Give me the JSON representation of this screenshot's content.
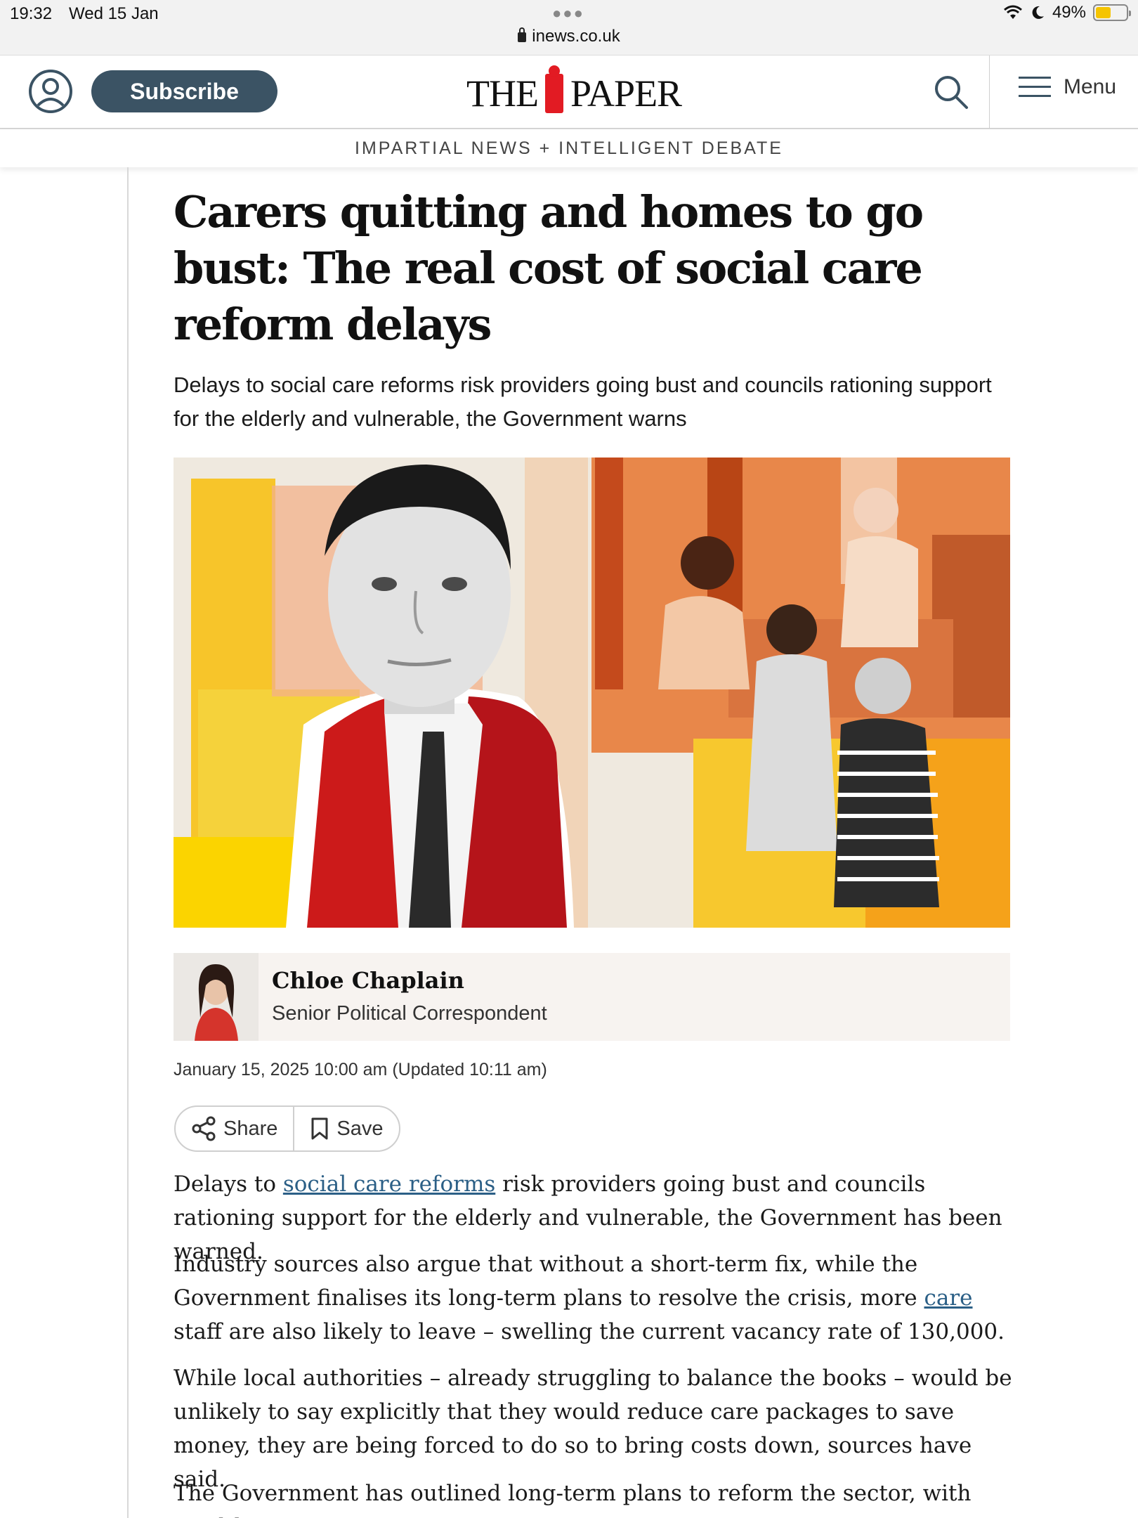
{
  "status_bar": {
    "time": "19:32",
    "date": "Wed 15 Jan",
    "url": "inews.co.uk",
    "battery": "49%",
    "battery_level": 0.49
  },
  "header": {
    "subscribe_label": "Subscribe",
    "logo_left": "THE",
    "logo_right": "PAPER",
    "menu_label": "Menu"
  },
  "tagline": "IMPARTIAL NEWS + INTELLIGENT DEBATE",
  "article": {
    "headline": "Carers quitting and homes to go bust: The real cost of social care reform delays",
    "standfirst": "Delays to social care reforms risk providers going bust and councils rationing support for the elderly and vulnerable, the Government warns",
    "author_name": "Chloe Chaplain",
    "author_role": "Senior Political Correspondent",
    "dateline": "January 15, 2025 10:00 am (Updated 10:11 am)",
    "share_label": "Share",
    "save_label": "Save",
    "p1": {
      "before": "Delays to ",
      "link": "social care reforms",
      "after": " risk providers going bust and councils rationing support for the elderly and vulnerable, the Government has been warned."
    },
    "p2": {
      "before": "Industry sources also argue that without a short-term fix, while the Government finalises its long-term plans to resolve the crisis, more ",
      "link": "care ",
      "after": "staff are also likely to leave – swelling the current vacancy rate of 130,000."
    },
    "p3": "While local authorities – already struggling to balance the books – would be unlikely to say explicitly that they would reduce care packages to save money, they are being forced to do so to bring costs down, sources have said.",
    "p4": "The Government has outlined long-term plans to reform the sector, with Health"
  },
  "colors": {
    "subscribe_bg": "#3b5364",
    "logo_i": "#e21b23",
    "link": "#2b5f86",
    "byline_bg": "#f7f3f0"
  }
}
